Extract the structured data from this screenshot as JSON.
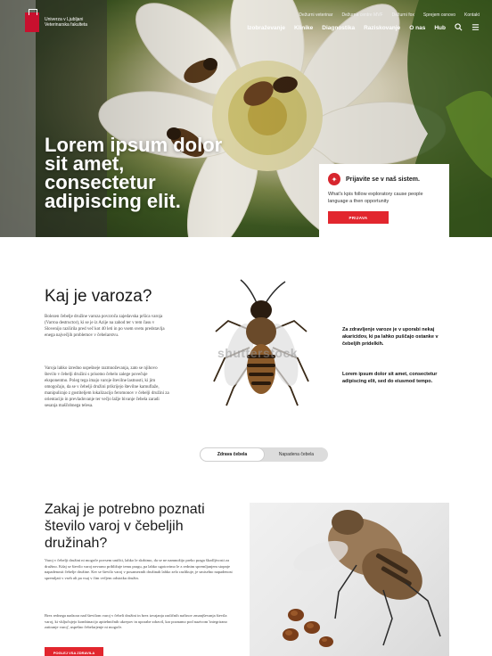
{
  "header": {
    "logo_text": "Univerza v Ljubljani Veterinarska fakulteta",
    "util_links": [
      "Dežurni veterinar",
      "Dežurna centre MVF",
      "Dežurni fox",
      "Sprejem osnovo",
      "Kontakt"
    ],
    "main_links": [
      "Izobraževanje",
      "Klinike",
      "Diagnostika",
      "Raziskovanje",
      "O nas",
      "Hub"
    ]
  },
  "hero": {
    "title": "Lorem ipsum dolor sit amet, consectetur adipiscing elit."
  },
  "login_card": {
    "title": "Prijavite se v naš sistem.",
    "text": "What's kpis follow exploratory cause people language a then opportunity",
    "button": "PRIJAVA"
  },
  "section1": {
    "title": "Kaj je varoza?",
    "p1": "Bolezen čebelje družine varoza povzroča zajedavska pršica varoja (Varroa destructor), ki se je iz Azije na zahod ter v tem času v Slovenijo razširila pred več kot 40 leti in po vsem svetu predstavlja enega največjih problemov v čebelarstvu.",
    "p2": "Varoja lahko izredno uspešneje razmnoževanja, zato se njihovo število v čebelji družini s prisotno čebelo zalege povečuje eksponentno. Poleg tega imajo varoje številne lastnosti, ki jim omogočajo, da se v čebelji družini prikrijejo številne kamuflaže, manipulirajo z gostiteljem lokalizacijo feromonov v čebelji družini za orientacijo in prevladovanje ter večjo lažje bivanje čebela zaradi sesanja maščobnega telesa.",
    "watermark": "shutterstock",
    "side1": "Za zdravljenje varoze je v uporabi nekaj akaricidov, ki pa lahko puščajo ostanke v čebeljih pridelkih.",
    "side2": "Lorem ipsum dolor sit amet, consectetur adipiscing elit, sed do eiusmod tempo.",
    "toggle": [
      "Zdrava čebela",
      "Napadena čebela"
    ]
  },
  "section2": {
    "title": "Zakaj je potrebno poznati število varoj v čebeljih družinah?",
    "p1": "Varoj v čebelji družini ni mogoče povsem uničiti, lahko le skrbimo, da se ne namnožijo preko praga škodljivosti za družino. Kdaj se število varoj nevarno približuje temu pragu, pa lahko ugotovimo le z rednim spremljanjem stopnje napadenosti čebelje družine. Ker se število varoj v posameznih družinah lahko zelo razlikuje, je smiselno napadenost spremljati v vseh ali pa vsaj v čim večjem odstotku družin.",
    "p2": "Brez rednega nadzora nad številom varoj v čebeli družini in brez izvajanja različnih načinov zmanjševanja števila varoj, ki vključujejo kombinacijo apitehničnih ukrepov in uporabe zdravil, kar poznamo pod nazivom 'integrirano zatiranje varoj', uspešno čebelarjenje ni mogoče.",
    "button": "POGLEJ VSA ZDRAVILA"
  },
  "colors": {
    "accent": "#e2262e",
    "logo": "#c8102e"
  }
}
